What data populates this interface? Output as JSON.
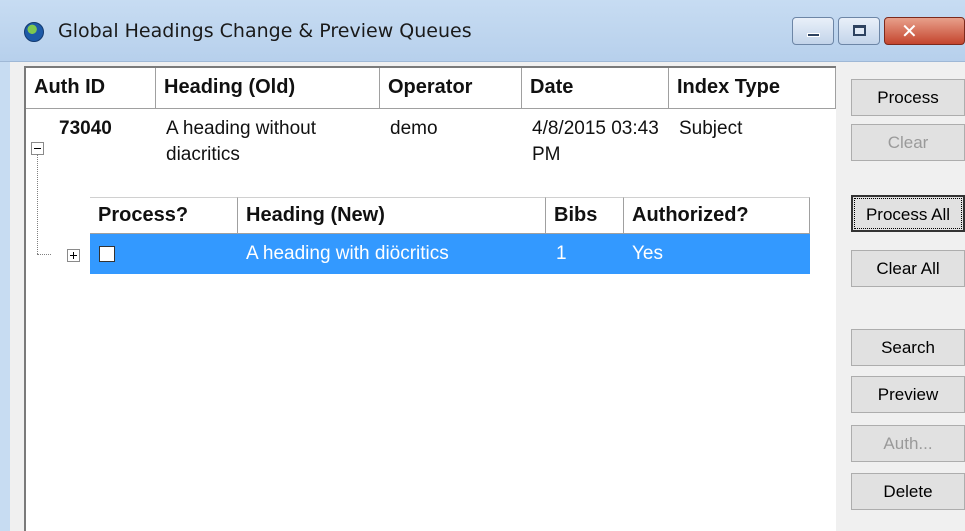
{
  "window": {
    "title": "Global Headings Change &  Preview Queues",
    "controls": [
      "minimize",
      "maximize",
      "close"
    ],
    "close_color": "#c4452e"
  },
  "grid": {
    "columns": [
      "Auth ID",
      "Heading (Old)",
      "Operator",
      "Date",
      "Index Type"
    ],
    "rows": [
      {
        "auth_id": "73040",
        "heading_old": "A heading without diacritics",
        "operator": "demo",
        "date": "4/8/2015 03:43 PM",
        "index_type": "Subject",
        "expanded": true
      }
    ],
    "sub_columns": [
      "Process?",
      "Heading (New)",
      "Bibs",
      "Authorized?"
    ],
    "sub_rows": [
      {
        "process_checked": false,
        "heading_new": "A heading with diöcritics",
        "bibs": "1",
        "authorized": "Yes",
        "selected": true
      }
    ],
    "selection_color": "#3399ff"
  },
  "buttons": {
    "process": {
      "label": "Process",
      "enabled": true
    },
    "clear": {
      "label": "Clear",
      "enabled": false
    },
    "process_all": {
      "label": "Process All",
      "enabled": true,
      "focused": true
    },
    "clear_all": {
      "label": "Clear All",
      "enabled": true
    },
    "search": {
      "label": "Search",
      "enabled": true
    },
    "preview": {
      "label": "Preview",
      "enabled": true
    },
    "auth": {
      "label": "Auth...",
      "enabled": false
    },
    "delete": {
      "label": "Delete",
      "enabled": true
    }
  }
}
